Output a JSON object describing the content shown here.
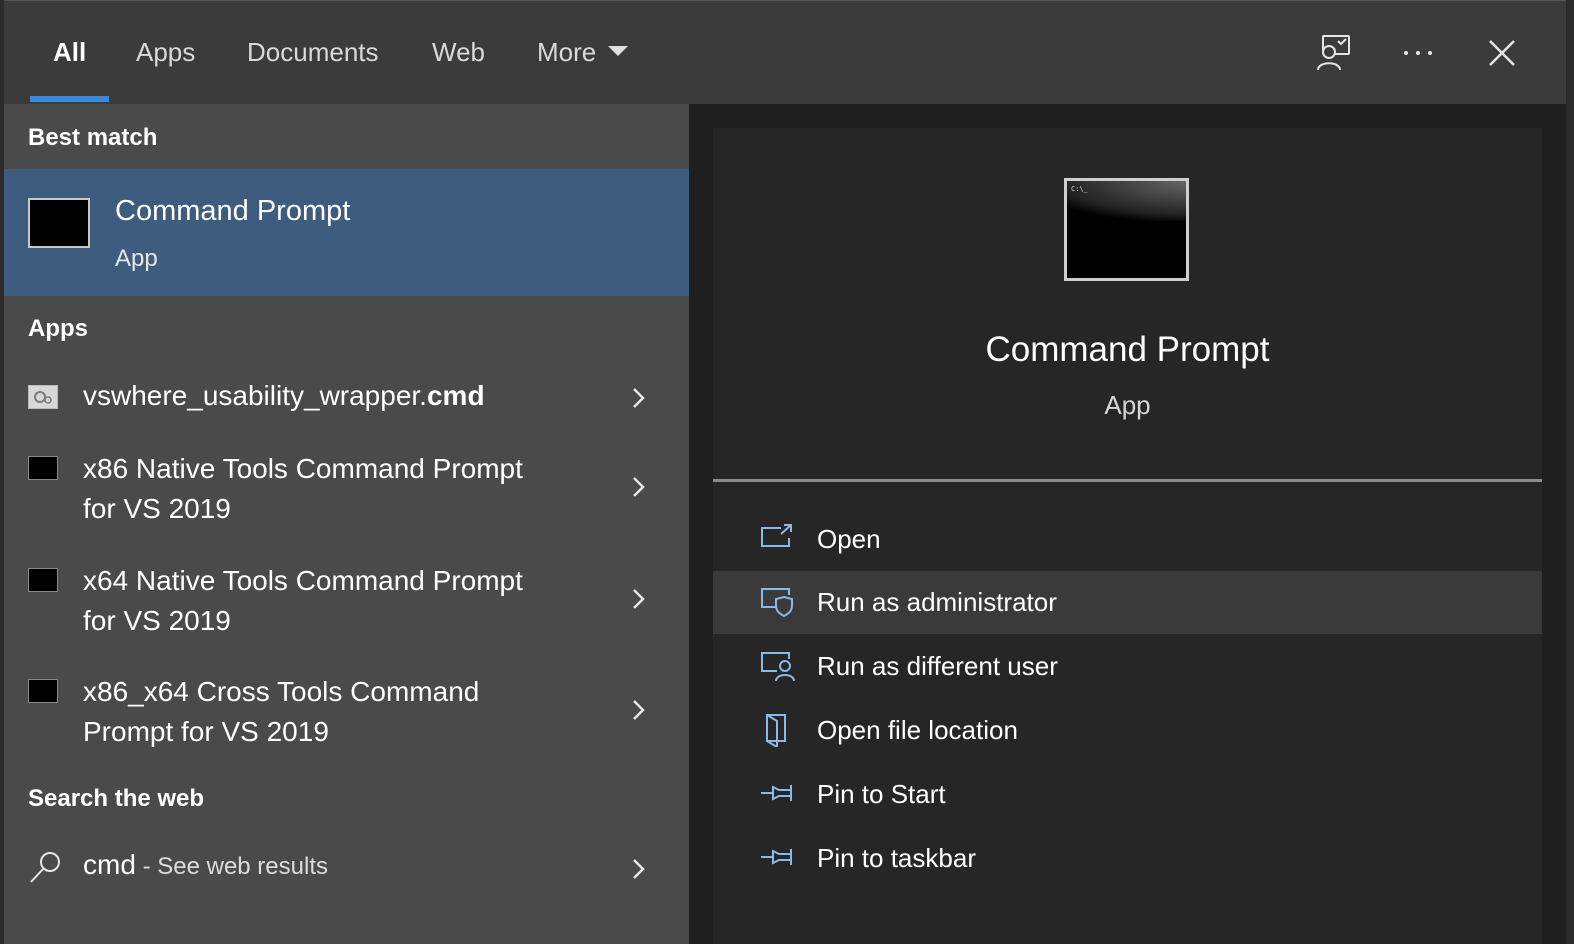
{
  "tabs": {
    "all": "All",
    "apps": "Apps",
    "documents": "Documents",
    "web": "Web",
    "more": "More"
  },
  "top_icons": [
    "feedback-icon",
    "more-options-icon",
    "close-icon"
  ],
  "left": {
    "best_match_header": "Best match",
    "best_match": {
      "title": "Command Prompt",
      "subtitle": "App"
    },
    "apps_header": "Apps",
    "apps": [
      {
        "label_plain": "vswhere_usability_wrapper.",
        "label_bold": "cmd",
        "line2": ""
      },
      {
        "label_plain": "x86 Native Tools Command Prompt",
        "label_bold": "",
        "line2": "for VS 2019"
      },
      {
        "label_plain": "x64 Native Tools Command Prompt",
        "label_bold": "",
        "line2": "for VS 2019"
      },
      {
        "label_plain": "x86_x64 Cross Tools Command",
        "label_bold": "",
        "line2": "Prompt for VS 2019"
      }
    ],
    "web_header": "Search the web",
    "web": {
      "query": "cmd",
      "suffix": " - See web results"
    }
  },
  "detail": {
    "icon_text": "C:\\_",
    "title": "Command Prompt",
    "subtitle": "App",
    "actions": [
      {
        "label": "Open",
        "icon": "open-icon"
      },
      {
        "label": "Run as administrator",
        "icon": "run-admin-icon"
      },
      {
        "label": "Run as different user",
        "icon": "run-user-icon"
      },
      {
        "label": "Open file location",
        "icon": "file-location-icon"
      },
      {
        "label": "Pin to Start",
        "icon": "pin-icon"
      },
      {
        "label": "Pin to taskbar",
        "icon": "pin-icon"
      }
    ]
  },
  "colors": {
    "accent": "#3b8ad9",
    "selected": "#3e5c7e",
    "icon_blue": "#8ab8e8"
  }
}
